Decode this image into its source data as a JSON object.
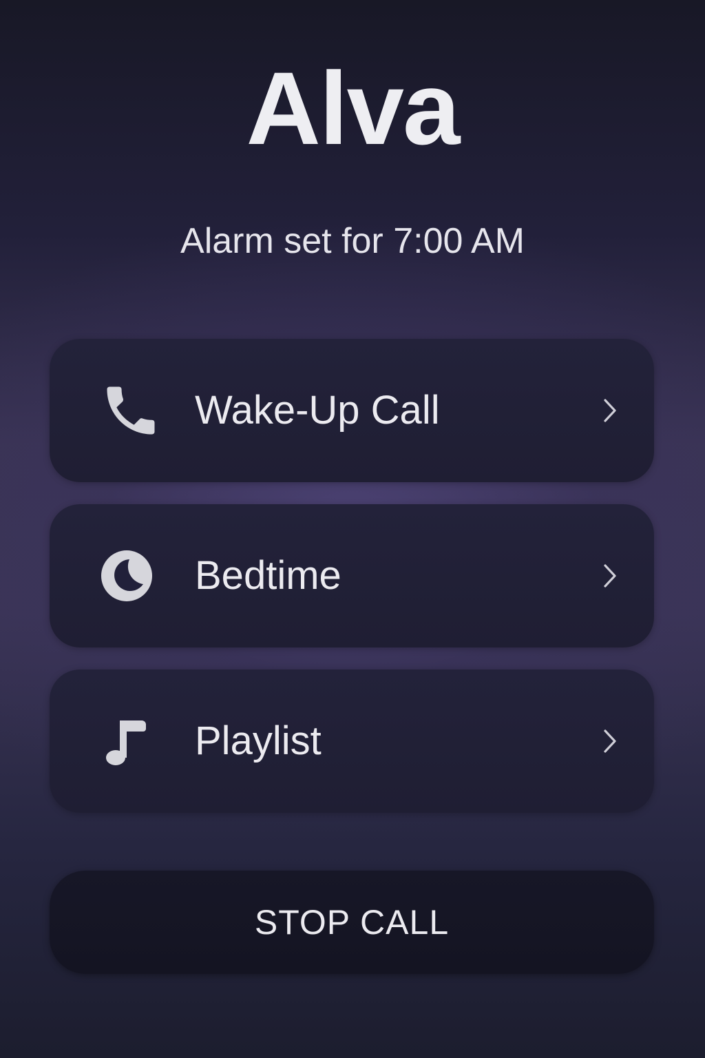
{
  "header": {
    "title": "Alva",
    "subtitle": "Alarm set for 7:00 AM"
  },
  "menu": [
    {
      "label": "Wake-Up Call",
      "icon": "phone-icon"
    },
    {
      "label": "Bedtime",
      "icon": "moon-icon"
    },
    {
      "label": "Playlist",
      "icon": "music-note-icon"
    }
  ],
  "actions": {
    "stop_label": "STOP CALL"
  },
  "colors": {
    "text": "#ECEBF0",
    "card": "#211F36",
    "stop_button": "#161625",
    "icon": "#D6D6DC"
  }
}
